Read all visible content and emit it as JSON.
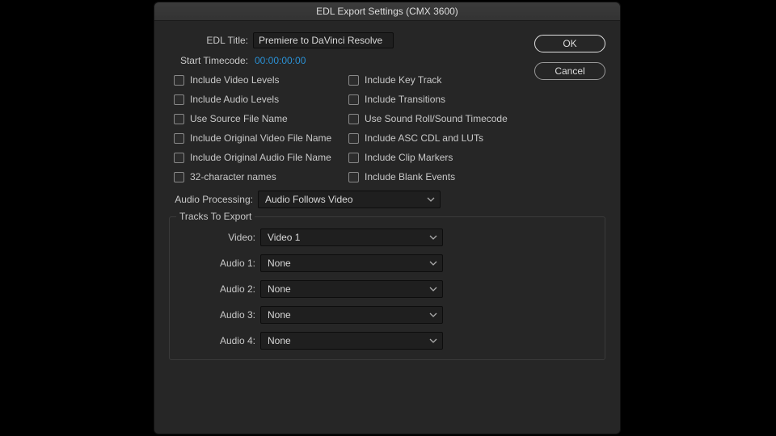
{
  "dialog": {
    "title": "EDL Export Settings (CMX 3600)"
  },
  "buttons": {
    "ok": "OK",
    "cancel": "Cancel"
  },
  "fields": {
    "edl_title_label": "EDL Title:",
    "edl_title_value": "Premiere to DaVinci Resolve",
    "start_tc_label": "Start Timecode:",
    "start_tc_value": "00:00:00:00"
  },
  "checks_left": {
    "0": "Include Video Levels",
    "1": "Include Audio Levels",
    "2": "Use Source File Name",
    "3": "Include Original Video File Name",
    "4": "Include Original Audio File Name",
    "5": "32-character names"
  },
  "checks_right": {
    "0": "Include Key Track",
    "1": "Include Transitions",
    "2": "Use Sound Roll/Sound Timecode",
    "3": "Include ASC CDL and LUTs",
    "4": "Include Clip Markers",
    "5": "Include Blank Events"
  },
  "audio_processing": {
    "label": "Audio Processing:",
    "value": "Audio Follows Video"
  },
  "tracks": {
    "legend": "Tracks To Export",
    "video_label": "Video:",
    "video_value": "Video 1",
    "a1_label": "Audio 1:",
    "a1_value": "None",
    "a2_label": "Audio 2:",
    "a2_value": "None",
    "a3_label": "Audio 3:",
    "a3_value": "None",
    "a4_label": "Audio 4:",
    "a4_value": "None"
  }
}
